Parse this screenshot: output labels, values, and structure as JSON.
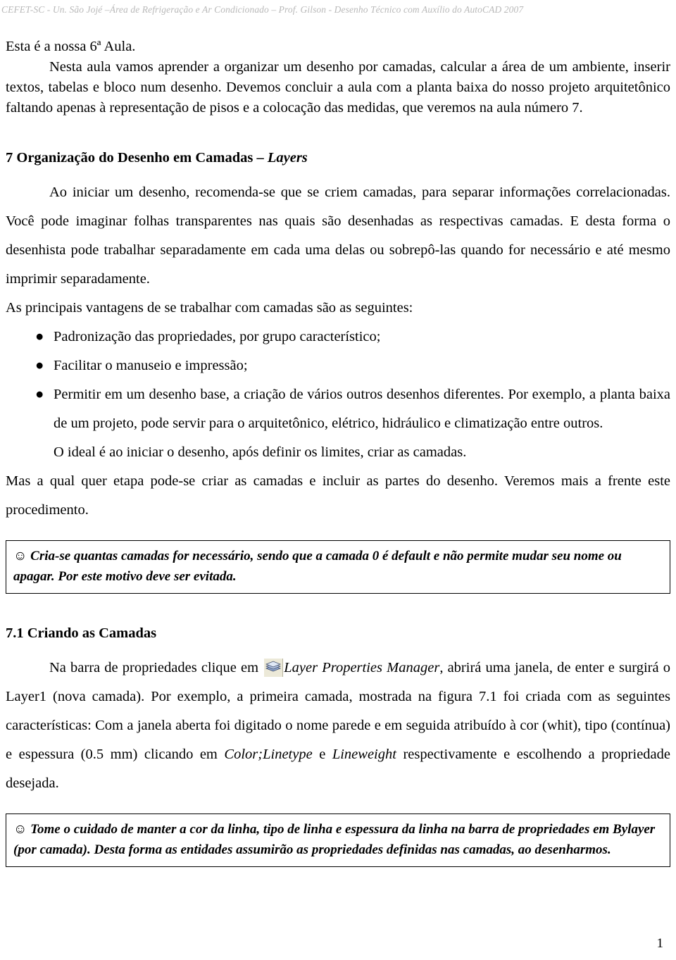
{
  "document": {
    "header": "CEFET-SC - Un. São Jojé –Área de Refrigeração e Ar Condicionado – Prof. Gilson - Desenho Técnico com Auxílio do AutoCAD 2007",
    "page_number": "1"
  },
  "intro": {
    "line1": "Esta é a nossa 6ª Aula.",
    "paragraph": "Nesta aula vamos aprender a organizar um desenho por camadas, calcular a área de um ambiente, inserir textos, tabelas e bloco num desenho. Devemos concluir a aula com a planta baixa do nosso projeto arquitetônico faltando apenas à representação de pisos e a colocação das medidas, que veremos na aula número 7."
  },
  "section7": {
    "number_and_title": "7 Organização do Desenho em Camadas – ",
    "title_italic": "Layers",
    "paragraph1": "Ao iniciar um desenho, recomenda-se que se criem camadas, para separar informações correlacionadas. Você pode imaginar folhas transparentes nas quais são desenhadas as respectivas camadas.  E desta forma o desenhista pode trabalhar separadamente em cada uma delas ou sobrepô-las quando for necessário e até mesmo imprimir separadamente.",
    "paragraph2": "As principais vantagens de se trabalhar com camadas são as seguintes:",
    "bullets": [
      "Padronização das propriedades, por grupo característico;",
      "Facilitar o manuseio e impressão;",
      "Permitir em um desenho base, a criação de vários outros desenhos diferentes. Por exemplo, a planta baixa de um projeto, pode servir para o arquitetônico, elétrico, hidráulico e climatização entre outros."
    ],
    "bullet_marker": "●",
    "after_bullets": "O ideal é ao iniciar o desenho, após definir os limites, criar as camadas.",
    "paragraph3": "Mas a qual quer etapa pode-se criar as camadas e incluir as partes do desenho. Veremos mais a frente este procedimento."
  },
  "note1": {
    "smiley": "☺",
    "text": " Cria-se quantas camadas for necessário, sendo que a camada 0 é default e não permite mudar seu nome ou apagar. Por este motivo deve ser evitada."
  },
  "section71": {
    "title": "7.1 Criando as Camadas",
    "text_before_icon": "Na barra de propriedades clique em ",
    "icon_name": "layer-properties-manager-icon",
    "icon_label": "Layer Properties Manager",
    "text_after_icon": ", abrirá uma janela, de enter e surgirá o Layer1 (nova camada).  Por exemplo, a primeira camada, mostrada na figura 7.1 foi criada com as seguintes características: Com a janela aberta foi digitado o nome parede e em seguida atribuído à cor (whit), tipo (contínua) e espessura (0.5 mm) clicando em ",
    "color_word": "Color;",
    "linetype_word": "Linetype",
    "and_word": " e ",
    "lineweight_word": "Lineweight",
    "text_tail": " respectivamente e escolhendo a propriedade desejada."
  },
  "note2": {
    "smiley": "☺",
    "text": " Tome o cuidado de manter a cor da linha, tipo de linha e espessura da linha na barra de propriedades em Bylayer (por camada). Desta forma as entidades assumirão as propriedades definidas nas camadas, ao desenharmos."
  },
  "colors": {
    "header_gray": "#b9b9b9",
    "text_black": "#000000",
    "icon_background": "#ece9d8",
    "icon_blue": "#7b94c4",
    "page_background": "#ffffff"
  }
}
